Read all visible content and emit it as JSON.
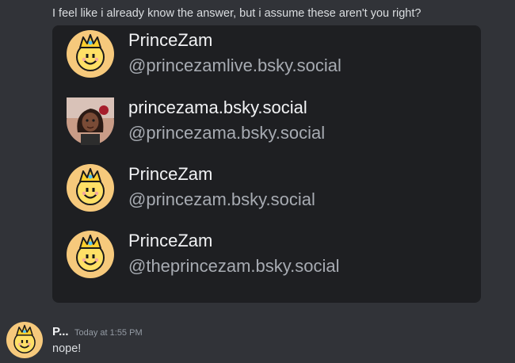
{
  "message": {
    "text": "I feel like i already know the answer, but i assume these aren't you right?"
  },
  "embed": {
    "accounts": [
      {
        "display_name": "PrinceZam",
        "handle": "@princezamlive.bsky.social",
        "avatar": "crowned-smiley-avatar"
      },
      {
        "display_name": "princezama.bsky.social",
        "handle": "@princezama.bsky.social",
        "avatar": "photo-girl-avatar"
      },
      {
        "display_name": "PrinceZam",
        "handle": "@princezam.bsky.social",
        "avatar": "crowned-smiley-avatar"
      },
      {
        "display_name": "PrinceZam",
        "handle": "@theprincezam.bsky.social",
        "avatar": "crowned-smiley-avatar"
      }
    ]
  },
  "reply": {
    "author": "P...",
    "timestamp": "Today at 1:55 PM",
    "text": "nope!",
    "avatar": "crowned-smiley-avatar"
  },
  "colors": {
    "background": "#313338",
    "embed_background": "#1e1f22",
    "text": "#dbdee1",
    "muted": "#a7abb2"
  }
}
